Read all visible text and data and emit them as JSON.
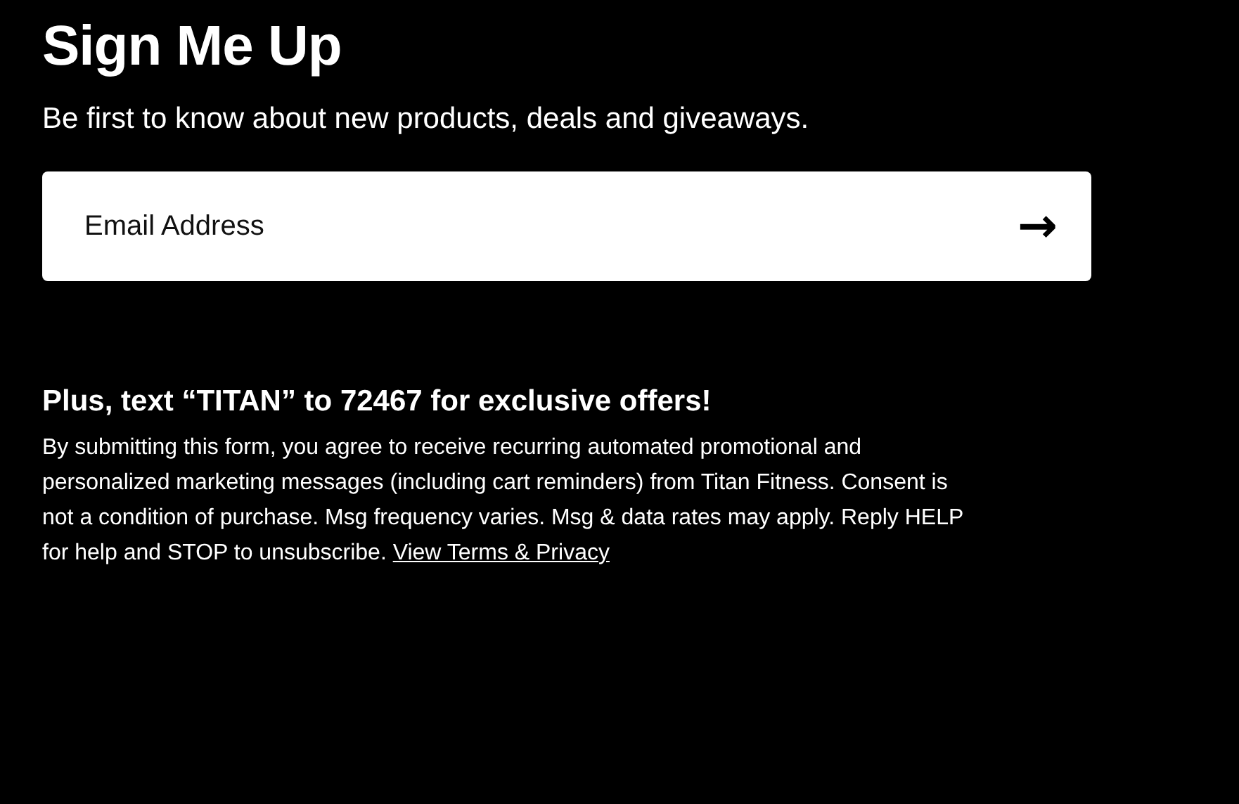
{
  "title": "Sign Me Up",
  "subtitle": "Be first to know about new products, deals and giveaways.",
  "email": {
    "placeholder": "Email Address",
    "submit": "→"
  },
  "sms_offer": "Plus, text “TITAN” to 72467 for exclusive offers!",
  "disclaimer": {
    "text": "By submitting this form, you agree to receive recurring automated promotional and personalized marketing messages (including cart reminders) from Titan Fitness. Consent is not a condition of purchase. Msg frequency varies. Msg & data rates may apply. Reply HELP for help and STOP to unsubscribe.",
    "link": "View Terms & Privacy"
  }
}
